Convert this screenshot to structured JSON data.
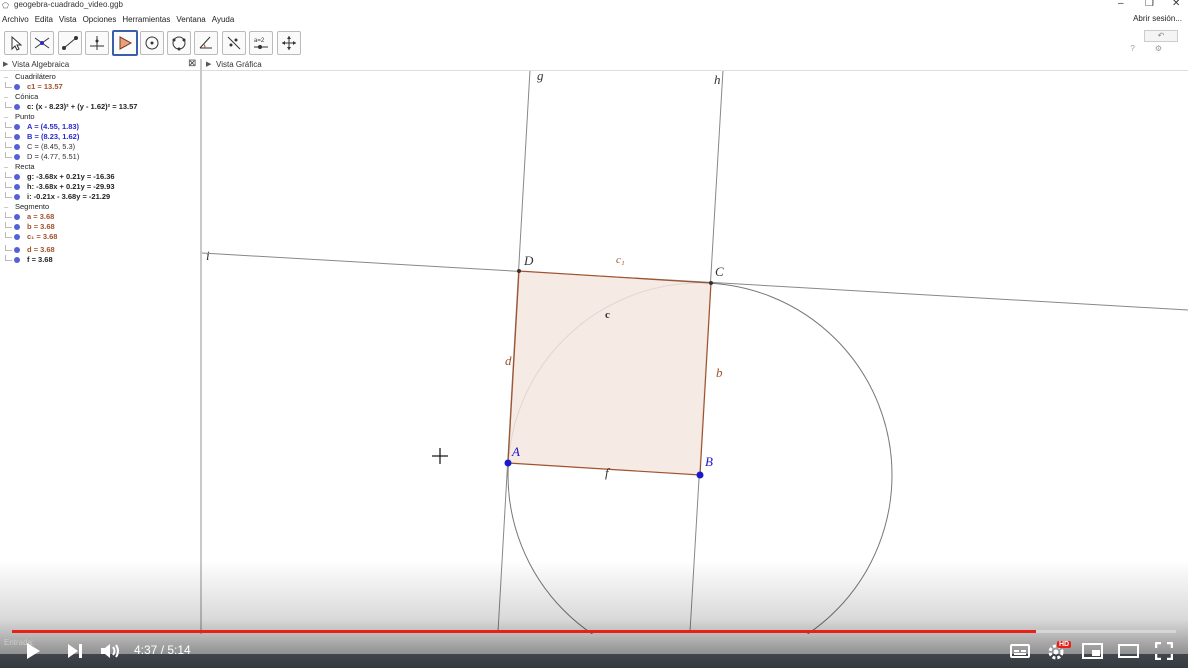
{
  "window": {
    "title": "geogebra-cuadrado_video.ggb",
    "sign_in": "Abrir sesión..."
  },
  "menu": [
    "Archivo",
    "Edita",
    "Vista",
    "Opciones",
    "Herramientas",
    "Ventana",
    "Ayuda"
  ],
  "toolbar": {
    "tools": [
      "move-tool",
      "point-intersect-tool",
      "segment-tool",
      "perpendicular-tool",
      "polygon-tool",
      "circle-tool",
      "conic-tool",
      "angle-tool",
      "reflect-tool",
      "slider-tool",
      "move-view-tool"
    ],
    "slider_label": "a=2",
    "selected": "polygon-tool"
  },
  "algebra_view": {
    "title": "Vista Algebraica",
    "groups": [
      {
        "name": "Cuadrilátero",
        "items": [
          {
            "text": "c1 = 13.57",
            "color": "brown",
            "bold": true
          }
        ]
      },
      {
        "name": "Cónica",
        "items": [
          {
            "text": "c: (x - 8.23)² + (y - 1.62)² = 13.57",
            "color": "dark",
            "bold": true
          }
        ]
      },
      {
        "name": "Punto",
        "items": [
          {
            "text": "A = (4.55, 1.83)",
            "color": "blue",
            "bold": true
          },
          {
            "text": "B = (8.23, 1.62)",
            "color": "blue",
            "bold": true
          },
          {
            "text": "C = (8.45, 5.3)",
            "color": "gray",
            "bold": false
          },
          {
            "text": "D = (4.77, 5.51)",
            "color": "gray",
            "bold": false
          }
        ]
      },
      {
        "name": "Recta",
        "items": [
          {
            "text": "g: -3.68x + 0.21y = -16.36",
            "color": "dark",
            "bold": true
          },
          {
            "text": "h: -3.68x + 0.21y = -29.93",
            "color": "dark",
            "bold": true
          },
          {
            "text": "i: -0.21x - 3.68y = -21.29",
            "color": "dark",
            "bold": true
          }
        ]
      },
      {
        "name": "Segmento",
        "items": [
          {
            "text": "a = 3.68",
            "color": "brown",
            "bold": true
          },
          {
            "text": "b = 3.68",
            "color": "brown",
            "bold": true
          },
          {
            "text": "c₁ = 3.68",
            "color": "brown",
            "bold": true
          },
          {
            "text": "d = 3.68",
            "color": "brown",
            "bold": true
          },
          {
            "text": "f = 3.68",
            "color": "dark",
            "bold": true
          }
        ]
      }
    ]
  },
  "graphics_view": {
    "title": "Vista Gráfica",
    "labels": {
      "g": "g",
      "h": "h",
      "i": "i",
      "A": "A",
      "B": "B",
      "C": "C",
      "D": "D",
      "c1": "c₁",
      "c": "c",
      "d": "d",
      "b": "b",
      "f": "f"
    },
    "colors": {
      "polygon_fill": "#f5e6df",
      "polygon_edge": "#a0522d",
      "point": "#1a1acc",
      "line": "#888888"
    }
  },
  "input_bar": {
    "label": "Entrada:"
  },
  "player": {
    "current_time": "4:37",
    "duration": "5:14",
    "progress": 0.88,
    "hd_badge": "HD"
  },
  "colors": {
    "accent": "#e62117",
    "selected_tool": "#3a5ea8"
  }
}
